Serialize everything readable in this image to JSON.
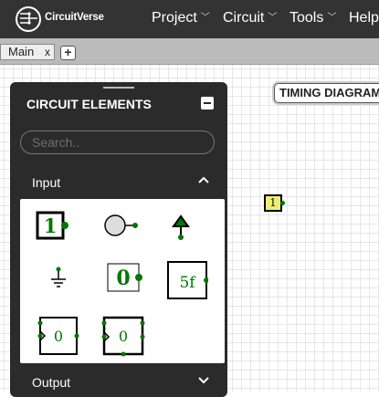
{
  "navbar": {
    "brand": "CircuitVerse",
    "menus": [
      {
        "label": "Project"
      },
      {
        "label": "Circuit"
      },
      {
        "label": "Tools"
      },
      {
        "label": "Help"
      }
    ]
  },
  "tabs": [
    {
      "label": "Main",
      "close": "x"
    }
  ],
  "add_tab_label": "+",
  "timing_diagram_label": "TIMING DIAGRAM",
  "panel": {
    "title": "CIRCUIT ELEMENTS",
    "search_placeholder": "Search..",
    "sections": [
      {
        "label": "Input",
        "expanded": true
      },
      {
        "label": "Output",
        "expanded": false
      }
    ],
    "input_elements": [
      {
        "name": "input",
        "glyph": "1"
      },
      {
        "name": "button"
      },
      {
        "name": "power"
      },
      {
        "name": "ground"
      },
      {
        "name": "constant-val",
        "glyph": "0"
      },
      {
        "name": "stepper",
        "glyph": "5f"
      },
      {
        "name": "random",
        "glyph": "0"
      },
      {
        "name": "counter",
        "glyph": "0"
      }
    ]
  },
  "canvas": {
    "input_node_value": "1"
  },
  "colors": {
    "navbar": "#333333",
    "panel": "#2b2b2b",
    "accent_green": "#007700",
    "element_fill": "#eeee77"
  }
}
